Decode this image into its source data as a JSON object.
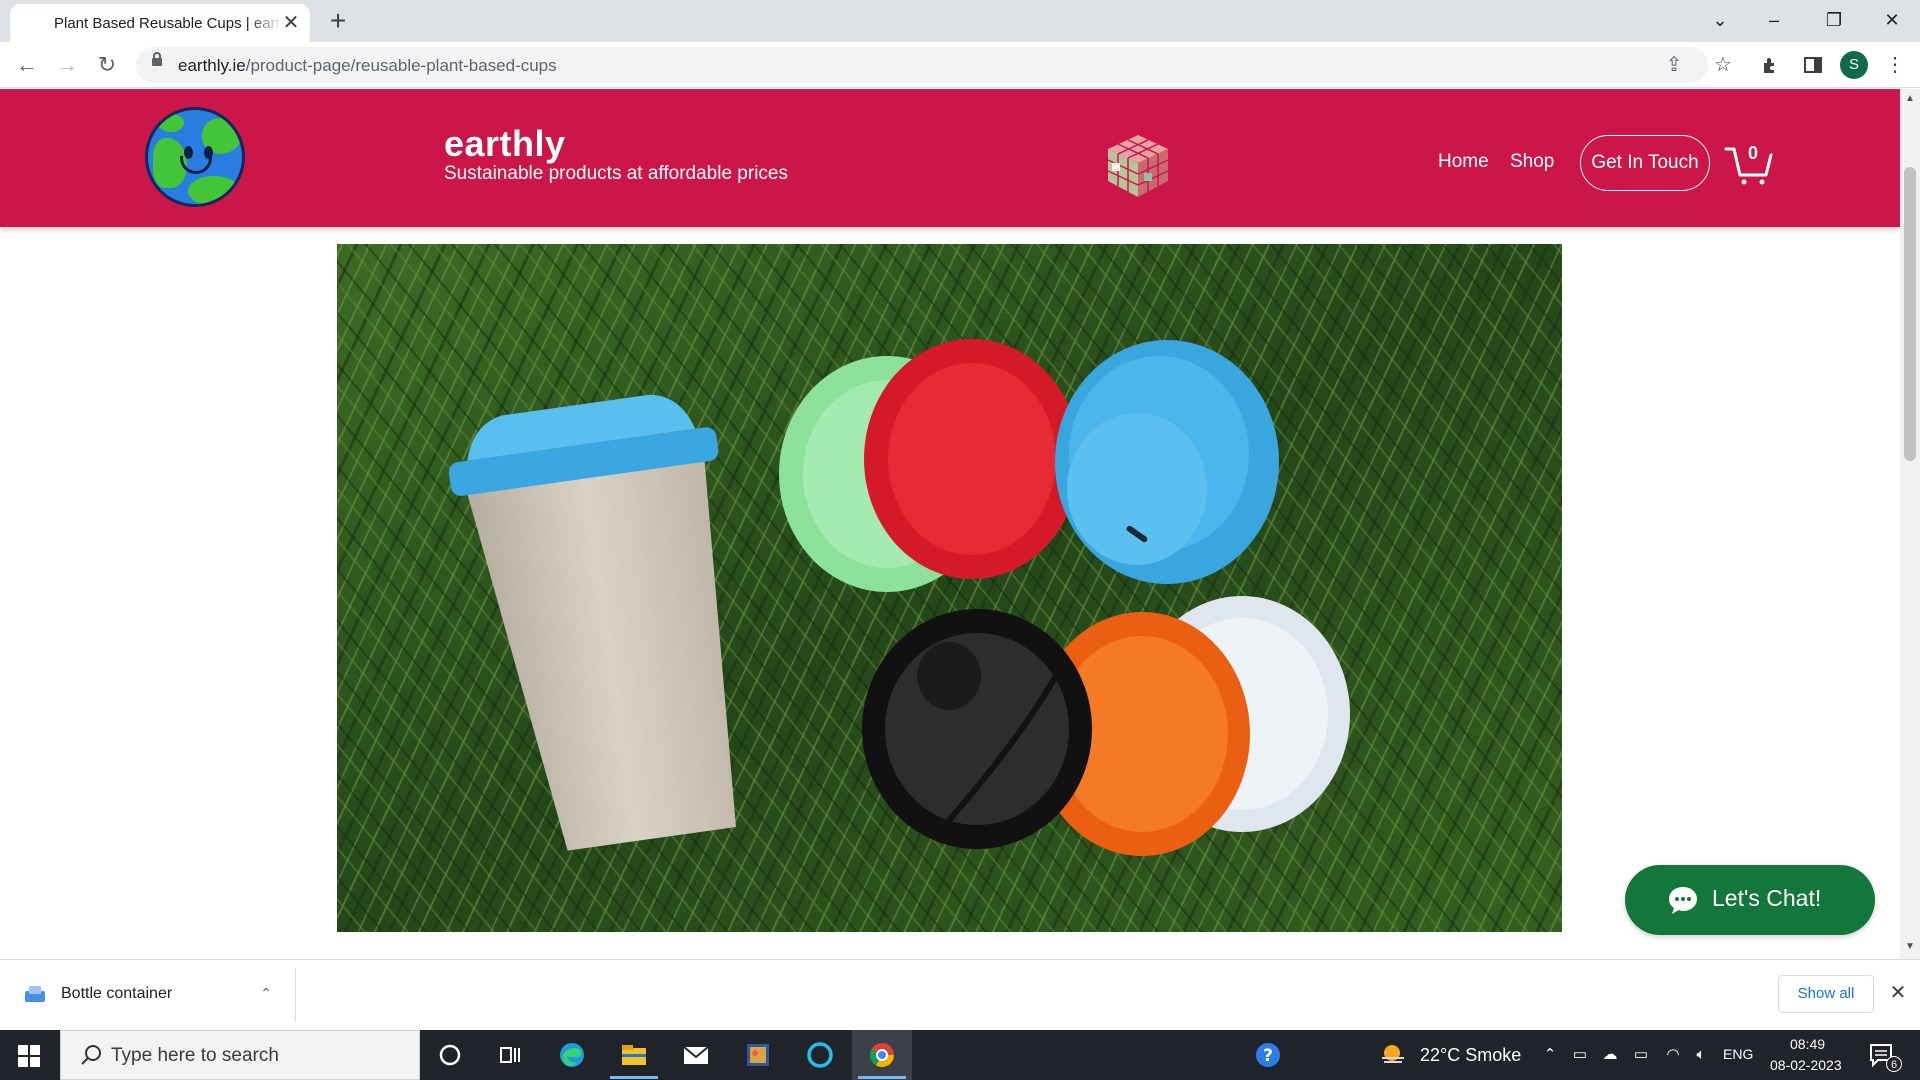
{
  "browser": {
    "tab_title": "Plant Based Reusable Cups | earthly",
    "url_host": "earthly.ie",
    "url_path": "/product-page/reusable-plant-based-cups",
    "profile_initial": "S"
  },
  "site": {
    "brand": "earthly",
    "tagline": "Sustainable products at affordable prices",
    "nav": {
      "home": "Home",
      "shop": "Shop",
      "contact": "Get In Touch"
    },
    "cart_count": "0",
    "chat_label": "Let's Chat!"
  },
  "hero": {
    "cup_lid_colors": [
      "#48b8ec",
      "#8de19a",
      "#db1c29",
      "#2a2a2a",
      "#f26c1a",
      "#e8eef5"
    ],
    "grass_color": "#2f5a1e"
  },
  "download_shelf": {
    "file_name": "Bottle container",
    "show_all": "Show all"
  },
  "taskbar": {
    "search_placeholder": "Type here to search",
    "weather": "22°C  Smoke",
    "language": "ENG",
    "time": "08:49",
    "date": "08-02-2023",
    "notifications": "6"
  },
  "colors": {
    "header": "#cc1548",
    "chat": "#13763a",
    "link_blue": "#1a73e8"
  }
}
